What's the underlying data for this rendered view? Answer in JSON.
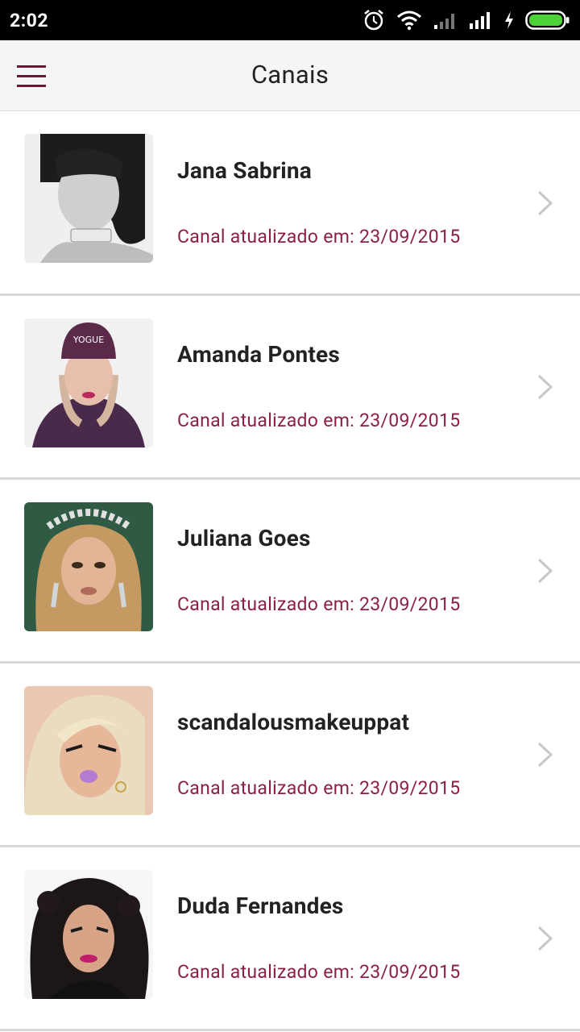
{
  "status_bar": {
    "time": "2:02",
    "icons": [
      "alarm-icon",
      "wifi-icon",
      "signal-icon",
      "signal-icon",
      "charging-icon",
      "battery-icon"
    ],
    "battery_color": "#4cd137"
  },
  "app_bar": {
    "title": "Canais",
    "menu_icon": "hamburger-menu-icon",
    "accent_color": "#6b1732"
  },
  "channels": [
    {
      "name": "Jana Sabrina",
      "updated": "Canal atualizado em: 23/09/2015",
      "avatar": "black-and-white portrait, dark hair with bangs"
    },
    {
      "name": "Amanda Pontes",
      "updated": "Canal atualizado em: 23/09/2015",
      "avatar": "woman in purple beanie and hoodie"
    },
    {
      "name": "Juliana Goes",
      "updated": "Canal atualizado em: 23/09/2015",
      "avatar": "woman with flower crown"
    },
    {
      "name": "scandalousmakeuppat",
      "updated": "Canal atualizado em: 23/09/2015",
      "avatar": "blonde woman with purple lips"
    },
    {
      "name": "Duda Fernandes",
      "updated": "Canal atualizado em: 23/09/2015",
      "avatar": "woman with curly dark hair"
    }
  ],
  "colors": {
    "subtitle": "#8c1f44",
    "divider": "#d9d9d9",
    "chevron": "#c8c8c8"
  }
}
